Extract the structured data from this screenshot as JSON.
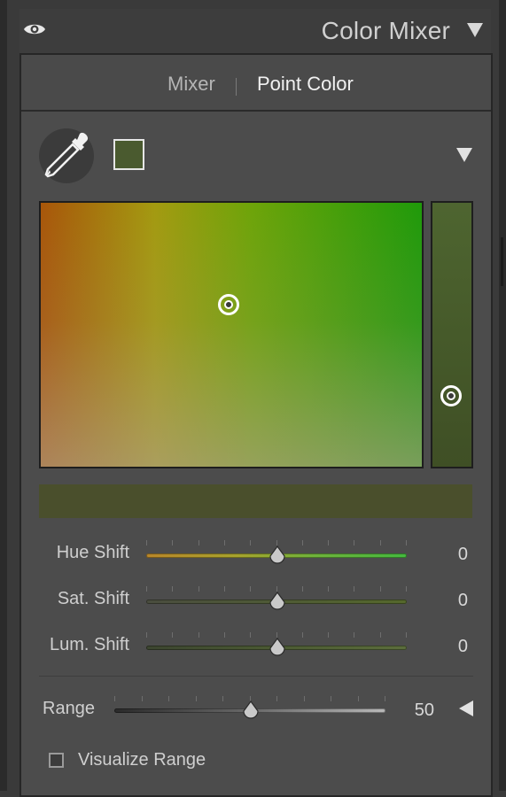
{
  "panel": {
    "title": "Color Mixer",
    "visibility_icon": "eye-icon",
    "collapse_icon": "triangle-down-icon"
  },
  "tabs": [
    {
      "label": "Mixer",
      "active": false
    },
    {
      "label": "Point Color",
      "active": true
    }
  ],
  "point_color": {
    "eyedropper_icon": "eyedropper-icon",
    "swatch_color": "#4a5a2f",
    "options_icon": "triangle-down-icon",
    "preview_color": "#4a4f2c"
  },
  "sliders": {
    "hue_shift": {
      "label": "Hue Shift",
      "value": "0",
      "position": 0.5
    },
    "sat_shift": {
      "label": "Sat. Shift",
      "value": "0",
      "position": 0.5
    },
    "lum_shift": {
      "label": "Lum. Shift",
      "value": "0",
      "position": 0.5
    },
    "range": {
      "label": "Range",
      "value": "50",
      "position": 0.5,
      "collapse_icon": "triangle-left-icon"
    }
  },
  "visualize_range": {
    "label": "Visualize Range",
    "checked": false
  }
}
